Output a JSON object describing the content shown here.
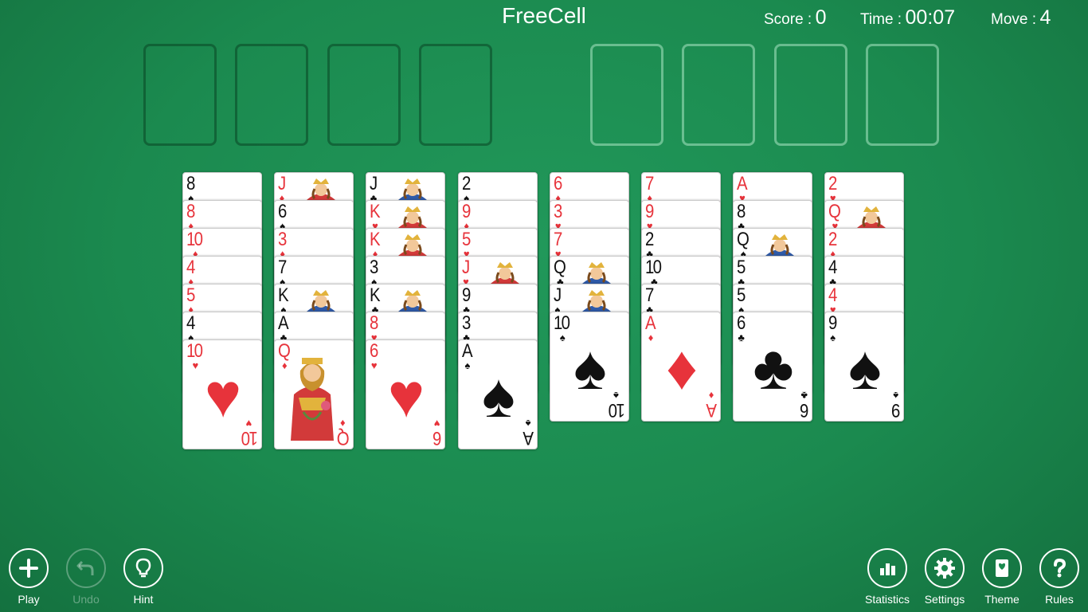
{
  "title": "FreeCell",
  "stats": {
    "score_label": "Score :",
    "score_value": "0",
    "time_label": "Time :",
    "time_value": "00:07",
    "move_label": "Move :",
    "move_value": "4"
  },
  "free_cells": [
    {
      "card": null
    },
    {
      "card": null
    },
    {
      "card": null
    },
    {
      "card": null
    }
  ],
  "foundations": [
    {
      "card": null
    },
    {
      "card": null
    },
    {
      "card": null
    },
    {
      "card": null
    }
  ],
  "columns": [
    [
      {
        "rank": "8",
        "suit": "spade"
      },
      {
        "rank": "8",
        "suit": "diamond"
      },
      {
        "rank": "10",
        "suit": "diamond"
      },
      {
        "rank": "4",
        "suit": "diamond"
      },
      {
        "rank": "5",
        "suit": "diamond"
      },
      {
        "rank": "4",
        "suit": "spade"
      },
      {
        "rank": "10",
        "suit": "heart"
      }
    ],
    [
      {
        "rank": "J",
        "suit": "diamond"
      },
      {
        "rank": "6",
        "suit": "spade"
      },
      {
        "rank": "3",
        "suit": "diamond"
      },
      {
        "rank": "7",
        "suit": "spade"
      },
      {
        "rank": "K",
        "suit": "spade"
      },
      {
        "rank": "A",
        "suit": "club"
      },
      {
        "rank": "Q",
        "suit": "diamond"
      }
    ],
    [
      {
        "rank": "J",
        "suit": "club"
      },
      {
        "rank": "K",
        "suit": "heart"
      },
      {
        "rank": "K",
        "suit": "diamond"
      },
      {
        "rank": "3",
        "suit": "spade"
      },
      {
        "rank": "K",
        "suit": "club"
      },
      {
        "rank": "8",
        "suit": "heart"
      },
      {
        "rank": "6",
        "suit": "heart"
      }
    ],
    [
      {
        "rank": "2",
        "suit": "spade"
      },
      {
        "rank": "9",
        "suit": "diamond"
      },
      {
        "rank": "5",
        "suit": "heart"
      },
      {
        "rank": "J",
        "suit": "heart"
      },
      {
        "rank": "9",
        "suit": "club"
      },
      {
        "rank": "3",
        "suit": "club"
      },
      {
        "rank": "A",
        "suit": "spade"
      }
    ],
    [
      {
        "rank": "6",
        "suit": "diamond"
      },
      {
        "rank": "3",
        "suit": "heart"
      },
      {
        "rank": "7",
        "suit": "heart"
      },
      {
        "rank": "Q",
        "suit": "club"
      },
      {
        "rank": "J",
        "suit": "spade"
      },
      {
        "rank": "10",
        "suit": "spade"
      }
    ],
    [
      {
        "rank": "7",
        "suit": "diamond"
      },
      {
        "rank": "9",
        "suit": "heart"
      },
      {
        "rank": "2",
        "suit": "club"
      },
      {
        "rank": "10",
        "suit": "club"
      },
      {
        "rank": "7",
        "suit": "club"
      },
      {
        "rank": "A",
        "suit": "diamond"
      }
    ],
    [
      {
        "rank": "A",
        "suit": "heart"
      },
      {
        "rank": "8",
        "suit": "club"
      },
      {
        "rank": "Q",
        "suit": "spade"
      },
      {
        "rank": "5",
        "suit": "club"
      },
      {
        "rank": "5",
        "suit": "spade"
      },
      {
        "rank": "6",
        "suit": "club"
      }
    ],
    [
      {
        "rank": "2",
        "suit": "heart"
      },
      {
        "rank": "Q",
        "suit": "heart"
      },
      {
        "rank": "2",
        "suit": "diamond"
      },
      {
        "rank": "4",
        "suit": "club"
      },
      {
        "rank": "4",
        "suit": "heart"
      },
      {
        "rank": "9",
        "suit": "spade"
      }
    ]
  ],
  "buttons_left": [
    {
      "id": "play",
      "label": "Play",
      "icon": "plus-icon",
      "enabled": true
    },
    {
      "id": "undo",
      "label": "Undo",
      "icon": "undo-arrow-icon",
      "enabled": false
    },
    {
      "id": "hint",
      "label": "Hint",
      "icon": "lightbulb-icon",
      "enabled": true
    }
  ],
  "buttons_right": [
    {
      "id": "statistics",
      "label": "Statistics",
      "icon": "bar-chart-icon",
      "enabled": true
    },
    {
      "id": "settings",
      "label": "Settings",
      "icon": "gear-icon",
      "enabled": true
    },
    {
      "id": "theme",
      "label": "Theme",
      "icon": "cards-icon",
      "enabled": true
    },
    {
      "id": "rules",
      "label": "Rules",
      "icon": "question-mark-icon",
      "enabled": true
    }
  ],
  "colors": {
    "felt": "#1b8a4f",
    "red_suit": "#e7333b",
    "black_suit": "#111111"
  }
}
